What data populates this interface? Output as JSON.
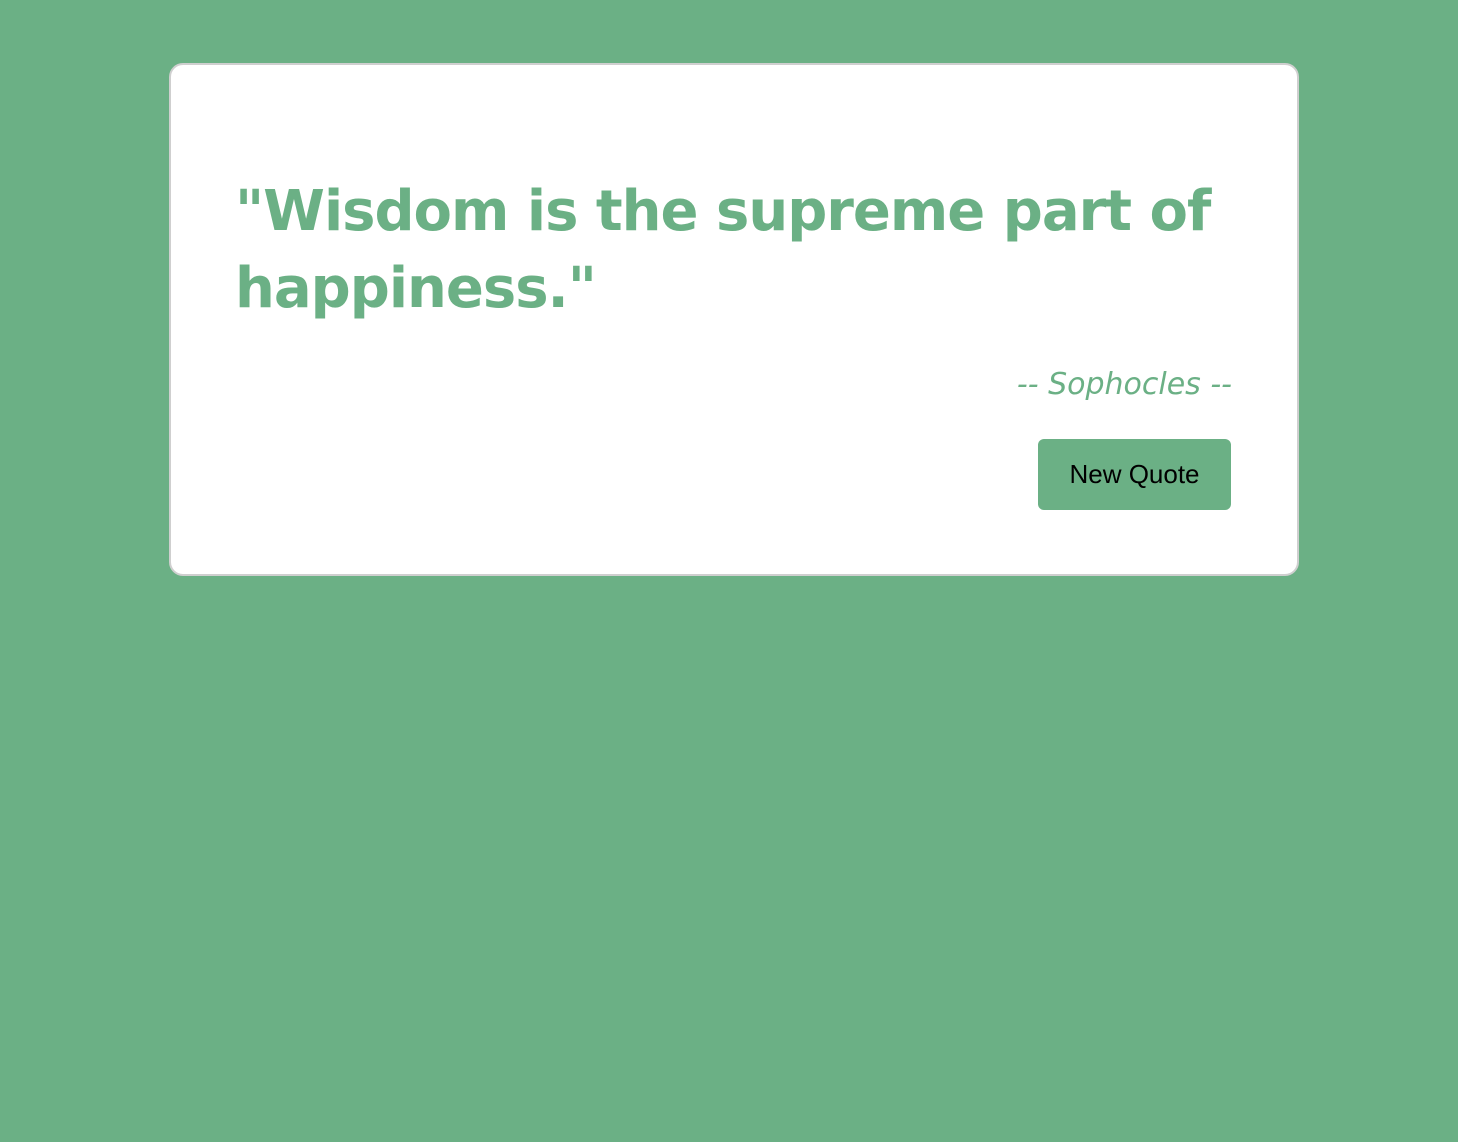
{
  "colors": {
    "background": "#6bb085",
    "accent": "#6bb085",
    "card": "#ffffff",
    "button_text": "#000000"
  },
  "quote_box": {
    "text": "\"Wisdom is the supreme part of happiness.\"",
    "author": "-- Sophocles --",
    "button_label": "New Quote"
  }
}
